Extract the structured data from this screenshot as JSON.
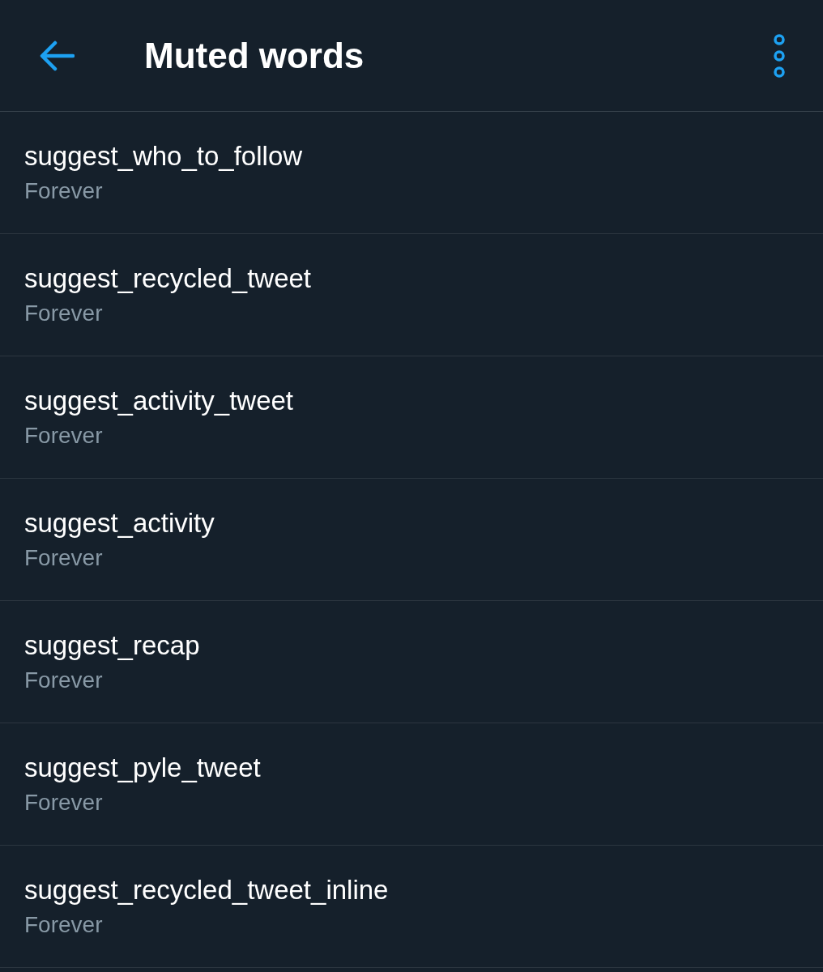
{
  "header": {
    "title": "Muted words"
  },
  "muted_words": [
    {
      "word": "suggest_who_to_follow",
      "duration": "Forever"
    },
    {
      "word": "suggest_recycled_tweet",
      "duration": "Forever"
    },
    {
      "word": "suggest_activity_tweet",
      "duration": "Forever"
    },
    {
      "word": "suggest_activity",
      "duration": "Forever"
    },
    {
      "word": "suggest_recap",
      "duration": "Forever"
    },
    {
      "word": "suggest_pyle_tweet",
      "duration": "Forever"
    },
    {
      "word": "suggest_recycled_tweet_inline",
      "duration": "Forever"
    }
  ]
}
